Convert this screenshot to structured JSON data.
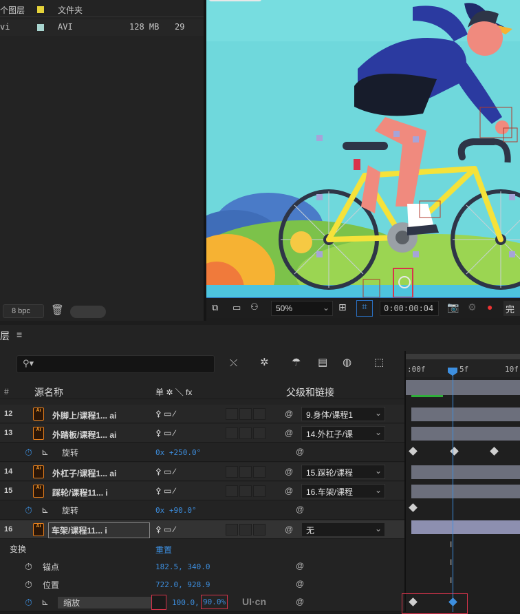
{
  "project": {
    "rows": [
      {
        "name": "个图层",
        "color": "#e5d33a",
        "type": "文件夹",
        "size": "",
        "extra": ""
      },
      {
        "name": "vi",
        "color": "#a8d5cf",
        "type": "AVI",
        "size": "128 MB",
        "extra": "29"
      }
    ],
    "bpc": "8 bpc"
  },
  "viewer": {
    "zoom": "50%",
    "timecode": "0:00:00:04",
    "extra_label": "完"
  },
  "timeline": {
    "panel_label": "层",
    "search_placeholder": "",
    "col_num": "#",
    "col_source": "源名称",
    "col_switches": "单 ✲ ＼ fx",
    "col_parent": "父级和链接",
    "ruler": {
      "start": ":00f",
      "mid": "5f",
      "end": "10f"
    },
    "layers": [
      {
        "num": "12",
        "name": "外脚上/课程1... ai",
        "parent": "9.身体/课程1"
      },
      {
        "num": "13",
        "name": "外踏板/课程1... ai",
        "parent": "14.外杠子/课"
      },
      {
        "num": "",
        "prop": "旋转",
        "value": "0x +250.0°"
      },
      {
        "num": "14",
        "name": "外杠子/课程1... ai",
        "parent": "15.踩轮/课程"
      },
      {
        "num": "15",
        "name": "踩轮/课程11... i",
        "parent": "16.车架/课程"
      },
      {
        "num": "",
        "prop": "旋转",
        "value": "0x +90.0°"
      },
      {
        "num": "16",
        "name": "车架/课程11... i",
        "parent": "无"
      }
    ],
    "transform": {
      "label": "变换",
      "reset": "重置"
    },
    "props": [
      {
        "name": "锚点",
        "value": "182.5, 340.0"
      },
      {
        "name": "位置",
        "value": "722.0, 928.9"
      },
      {
        "name": "缩放",
        "value_a": "100.0,",
        "value_b": "90.0%"
      }
    ],
    "watermark": "UI·cn"
  }
}
